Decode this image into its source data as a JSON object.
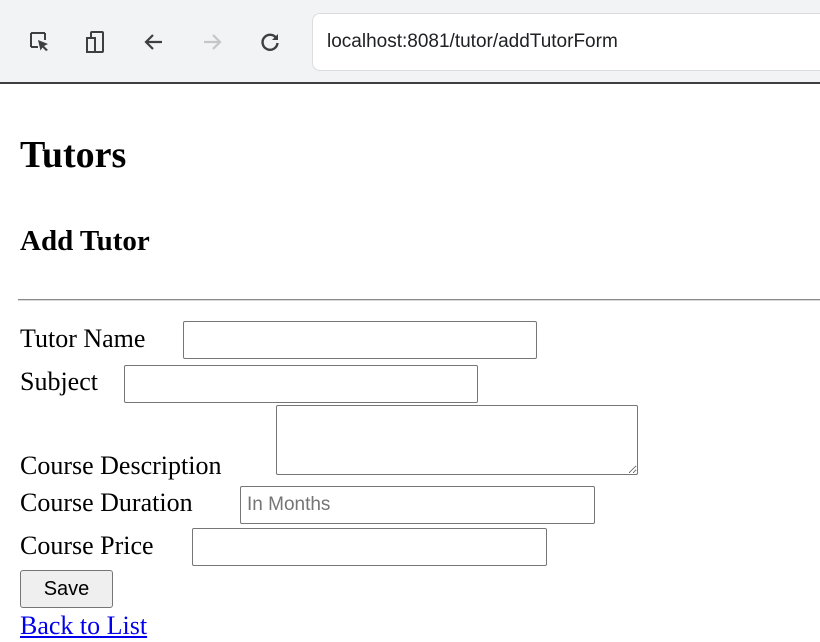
{
  "browser": {
    "url": "localhost:8081/tutor/addTutorForm"
  },
  "page": {
    "title": "Tutors",
    "subtitle": "Add Tutor"
  },
  "form": {
    "tutor_name_label": "Tutor Name",
    "tutor_name_value": "",
    "subject_label": "Subject",
    "subject_value": "",
    "course_description_label": "Course Description",
    "course_description_value": "",
    "course_duration_label": "Course Duration",
    "course_duration_value": "",
    "course_duration_placeholder": "In Months",
    "course_price_label": "Course Price",
    "course_price_value": "",
    "save_label": "Save"
  },
  "links": {
    "back_to_list": "Back to List"
  },
  "icons": {
    "inspect": "inspect-element-icon",
    "device": "device-toolbar-icon",
    "back": "back-arrow-icon",
    "forward": "forward-arrow-icon",
    "reload": "reload-icon"
  },
  "colors": {
    "toolbar_bg": "#f1f3f4",
    "link": "#0000ee",
    "icon": "#3c4043",
    "icon_disabled": "#c4c7c5"
  }
}
